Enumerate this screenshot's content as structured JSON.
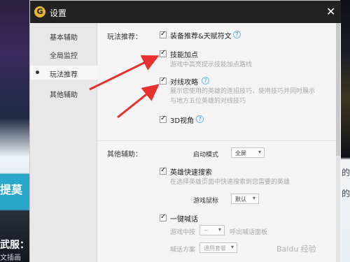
{
  "background": {
    "left_texts": [
      "提莫",
      "武服：",
      "文插画"
    ],
    "right_texts": [
      "的",
      "的"
    ]
  },
  "window": {
    "logo": "G",
    "title": "设置",
    "close": "✕"
  },
  "sidebar": {
    "items": [
      {
        "label": "基本辅助"
      },
      {
        "label": "全局监控"
      },
      {
        "label": "玩法推荐"
      },
      {
        "label": "其他辅助"
      }
    ]
  },
  "recommend": {
    "section_label": "玩法推荐：",
    "equip": {
      "label": "装备推荐&天赋符文",
      "checked": true
    },
    "skill": {
      "label": "技能加点",
      "checked": true,
      "desc": "游戏中高亮提示技能加点路线"
    },
    "guide": {
      "label": "对线攻略",
      "checked": true,
      "desc_line1": "展示您使用的英雄的连招技巧，使用技巧并同时展示",
      "desc_line2": "与地方五位英雄的对线技巧"
    },
    "view3d": {
      "label": "3D视角",
      "checked": true
    }
  },
  "other": {
    "section_label": "其他辅助：",
    "start_mode": {
      "label": "启动模式",
      "value": "全屏"
    },
    "hero_search": {
      "label": "英雄快速搜索",
      "checked": true,
      "desc": "在选择英雄页面中快速搜索到您需要的英雄"
    },
    "mouse": {
      "label": "游戏鼠标",
      "value": "默认"
    },
    "shout": {
      "label": "一键喊话",
      "checked": true
    },
    "shout_key": {
      "label_pre": "游戏中按",
      "value": "~",
      "label_post": "呼出喊话面板"
    },
    "shout_plan": {
      "label": "喊话方案",
      "value": "通用套餐"
    }
  },
  "icons": {
    "help": "?",
    "dropdown": "▾"
  },
  "watermark": "Baidu 经验",
  "colors": {
    "arrow": "#e8302e",
    "titlebar": "#222222",
    "help": "#4a9bd0"
  }
}
